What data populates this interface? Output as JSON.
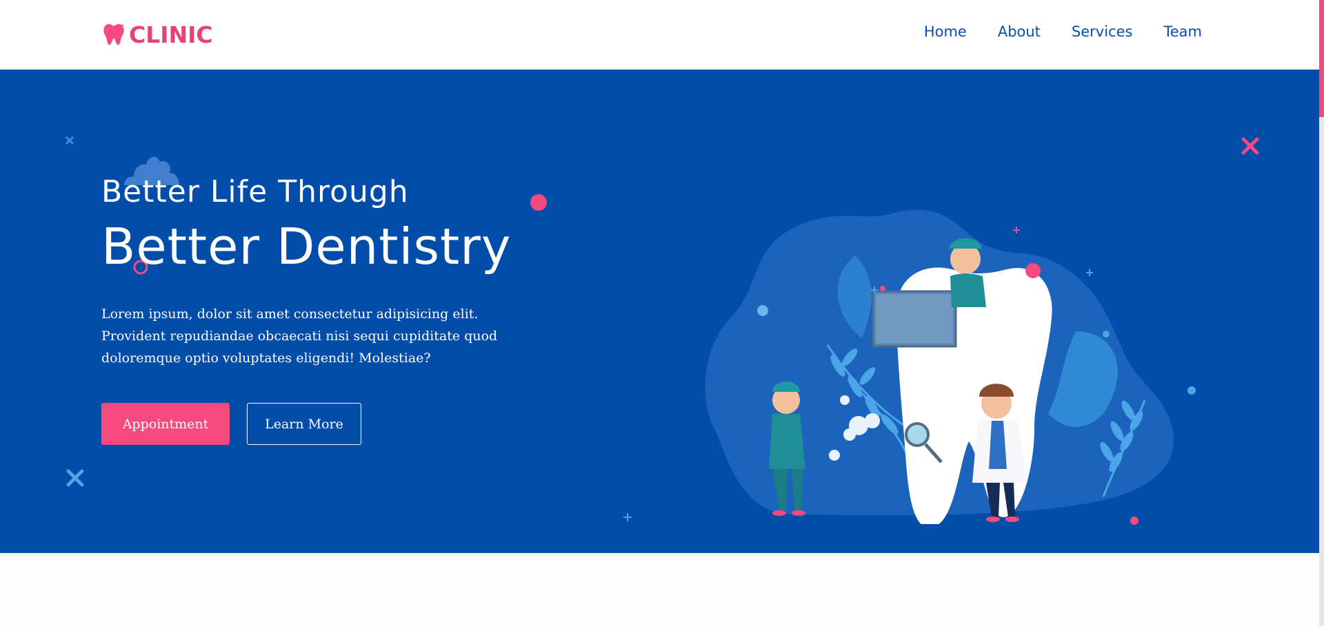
{
  "brand": {
    "name": "CLINIC",
    "accent": "#f5497f",
    "primary": "#014da9"
  },
  "nav": {
    "items": [
      {
        "label": "Home"
      },
      {
        "label": "About"
      },
      {
        "label": "Services"
      },
      {
        "label": "Team"
      }
    ]
  },
  "hero": {
    "subtitle": "Better Life Through",
    "title": "Better Dentistry",
    "description": "Lorem ipsum, dolor sit amet consectetur adipisicing elit. Provident repudiandae obcaecati nisi sequi cupiditate quod doloremque optio voluptates eligendi! Molestiae?",
    "primary_button": "Appointment",
    "secondary_button": "Learn More",
    "illustration_icon": "dentist-team-illustration"
  }
}
